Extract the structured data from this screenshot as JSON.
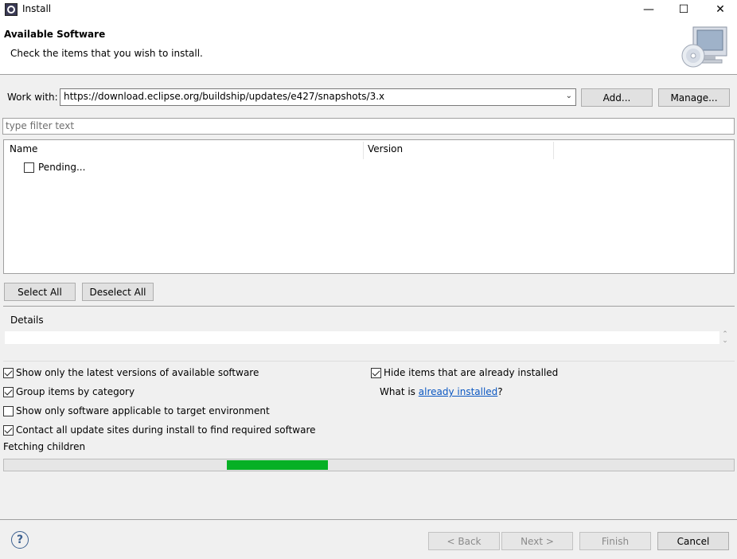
{
  "window": {
    "title": "Install",
    "minimize_glyph": "—",
    "maximize_glyph": "☐",
    "close_glyph": "✕"
  },
  "banner": {
    "title": "Available Software",
    "description": "Check the items that you wish to install."
  },
  "work_with": {
    "label": "Work with:",
    "value": "https://download.eclipse.org/buildship/updates/e427/snapshots/3.x",
    "add_label": "Add...",
    "manage_label": "Manage..."
  },
  "filter": {
    "placeholder": "type filter text"
  },
  "table": {
    "columns": [
      "Name",
      "Version"
    ],
    "rows": [
      {
        "name": "Pending...",
        "checked": false
      }
    ]
  },
  "selection": {
    "select_all": "Select All",
    "deselect_all": "Deselect All"
  },
  "details": {
    "label": "Details"
  },
  "options": {
    "show_latest": {
      "label": "Show only the latest versions of available software",
      "checked": true
    },
    "group_by_category": {
      "label": "Group items by category",
      "checked": true
    },
    "show_applicable": {
      "label": "Show only software applicable to target environment",
      "checked": false
    },
    "contact_sites": {
      "label": "Contact all update sites during install to find required software",
      "checked": true
    },
    "hide_installed": {
      "label": "Hide items that are already installed",
      "checked": true
    },
    "what_is_prefix": "What is ",
    "what_is_link": "already installed",
    "what_is_suffix": "?"
  },
  "status": {
    "text": "Fetching children",
    "progress_color": "#06b025"
  },
  "footer": {
    "help_glyph": "?",
    "back": "< Back",
    "next": "Next >",
    "finish": "Finish",
    "cancel": "Cancel"
  }
}
